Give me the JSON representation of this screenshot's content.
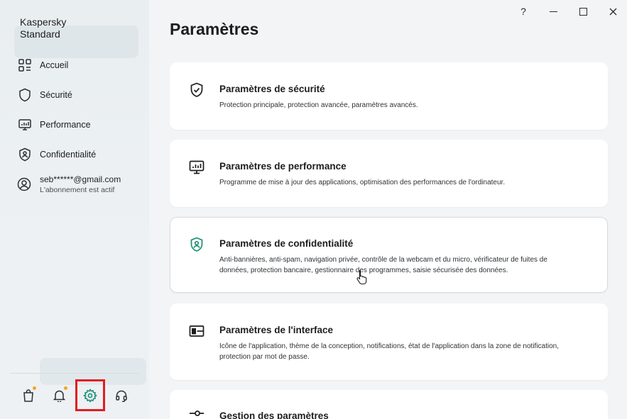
{
  "app": {
    "title": "Kaspersky Standard"
  },
  "sidebar": {
    "items": [
      {
        "label": "Accueil",
        "icon": "home-grid-icon"
      },
      {
        "label": "Sécurité",
        "icon": "shield-icon"
      },
      {
        "label": "Performance",
        "icon": "monitor-icon"
      },
      {
        "label": "Confidentialité",
        "icon": "privacy-shield-icon"
      }
    ],
    "account": {
      "email": "seb******@gmail.com",
      "status": "L'abonnement est actif",
      "icon": "user-circle-icon"
    },
    "bottom": [
      {
        "name": "store",
        "icon": "shopping-bag-icon",
        "badge": true
      },
      {
        "name": "notifications",
        "icon": "bell-icon",
        "badge": true
      },
      {
        "name": "settings",
        "icon": "gear-icon",
        "badge": false,
        "active": true
      },
      {
        "name": "support",
        "icon": "headset-icon",
        "badge": false
      }
    ]
  },
  "titlebar": {
    "help": "?",
    "minimize": "—",
    "maximize": "☐",
    "close": "✕"
  },
  "main": {
    "title": "Paramètres",
    "cards": [
      {
        "title": "Paramètres de sécurité",
        "description": "Protection principale, protection avancée, paramètres avancés.",
        "icon": "shield-check-icon"
      },
      {
        "title": "Paramètres de performance",
        "description": "Programme de mise à jour des applications, optimisation des performances de l'ordinateur.",
        "icon": "monitor-icon"
      },
      {
        "title": "Paramètres de confidentialité",
        "description": "Anti-bannières, anti-spam, navigation privée, contrôle de la webcam et du micro, vérificateur de fuites de données, protection bancaire, gestionnaire des programmes, saisie sécurisée des données.",
        "icon": "privacy-shield-icon"
      },
      {
        "title": "Paramètres de l'interface",
        "description": "Icône de l'application, thème de la conception, notifications, état de l'application dans la zone de notification, protection par mot de passe.",
        "icon": "layout-icon"
      },
      {
        "title": "Gestion des paramètres",
        "description": "",
        "icon": "sliders-icon"
      }
    ]
  },
  "colors": {
    "accent": "#1a8f74",
    "badge": "#f5a623",
    "highlight": "#e21d1d"
  }
}
